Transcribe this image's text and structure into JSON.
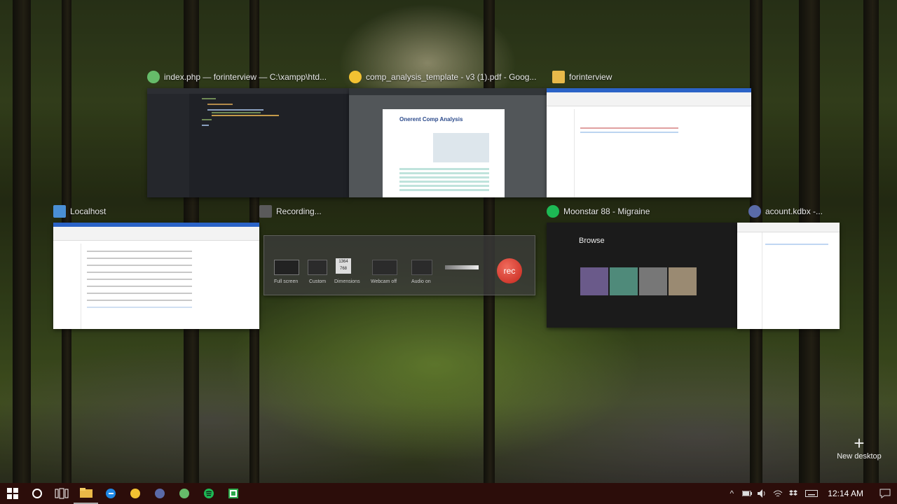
{
  "windows": {
    "editor": {
      "title": "index.php — forinterview — C:\\xampp\\htd..."
    },
    "pdf": {
      "title": "comp_analysis_template - v3 (1).pdf - Goog...",
      "page_heading": "Onerent Comp Analysis"
    },
    "folder1": {
      "title": "forinterview"
    },
    "localhost": {
      "title": "Localhost"
    },
    "recording": {
      "title": "Recording...",
      "labels": [
        "Full screen",
        "Custom",
        "Dimensions",
        "Webcam off",
        "Audio on"
      ],
      "dims": [
        "1364",
        "768"
      ],
      "rec": "rec"
    },
    "spotify": {
      "title": "Moonstar 88 - Migraine",
      "browse": "Browse"
    },
    "keepass": {
      "title": "acount.kdbx -..."
    }
  },
  "new_desktop": {
    "label": "New desktop"
  },
  "taskbar": {
    "clock": "12:14 AM",
    "apps": [
      "start-icon",
      "cortana-icon",
      "task-view-icon",
      "file-explorer-icon",
      "edge-icon",
      "chrome-icon",
      "keepass-icon",
      "atom-icon",
      "spotify-icon",
      "camtasia-icon"
    ]
  }
}
